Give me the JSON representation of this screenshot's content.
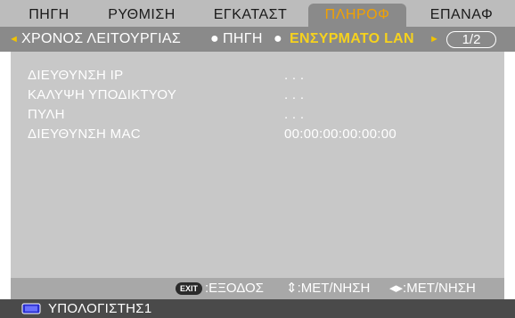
{
  "tabs": [
    {
      "label": "ΠΗΓΗ"
    },
    {
      "label": "ΡΥΘΜΙΣΗ"
    },
    {
      "label": "ΕΓΚΑΤΑΣΤ"
    },
    {
      "label": "ΠΛΗΡΟΦ",
      "active": true
    },
    {
      "label": "ΕΠΑΝΑΦ"
    }
  ],
  "subtabs": {
    "left_arrow": "◄",
    "items": [
      "ΧΡΟΝΟΣ ΛΕΙΤΟΥΡΓΙΑΣ",
      "ΠΗΓΗ",
      "ΕΝΣΥΡΜΑΤΟ LAN"
    ],
    "separator": "●",
    "right_arrow": "►",
    "page": "1/2"
  },
  "info": {
    "rows": [
      {
        "label": "ΔΙΕΥΘΥΝΣΗ IP",
        "value": ". . ."
      },
      {
        "label": "ΚΑΛΥΨΗ ΥΠΟΔΙΚΤΥΟΥ",
        "value": ". . ."
      },
      {
        "label": "ΠΥΛΗ",
        "value": ". . ."
      },
      {
        "label": "ΔΙΕΥΘΥΝΣΗ MAC",
        "value": "00:00:00:00:00:00"
      }
    ]
  },
  "help": {
    "exit_badge": "EXIT",
    "exit_text": ":ΕΞΟΔΟΣ",
    "updown_text": "⇕:ΜΕΤ/ΝΗΣΗ",
    "leftright_text": "◂▸:ΜΕΤ/ΝΗΣΗ"
  },
  "status": {
    "source_icon": "computer-monitor-icon",
    "source_label": "ΥΠΟΛΟΓΙΣΤΗΣ1"
  },
  "colors": {
    "active_tab_text": "#f2a100",
    "active_subtab_text": "#f6d21e"
  }
}
